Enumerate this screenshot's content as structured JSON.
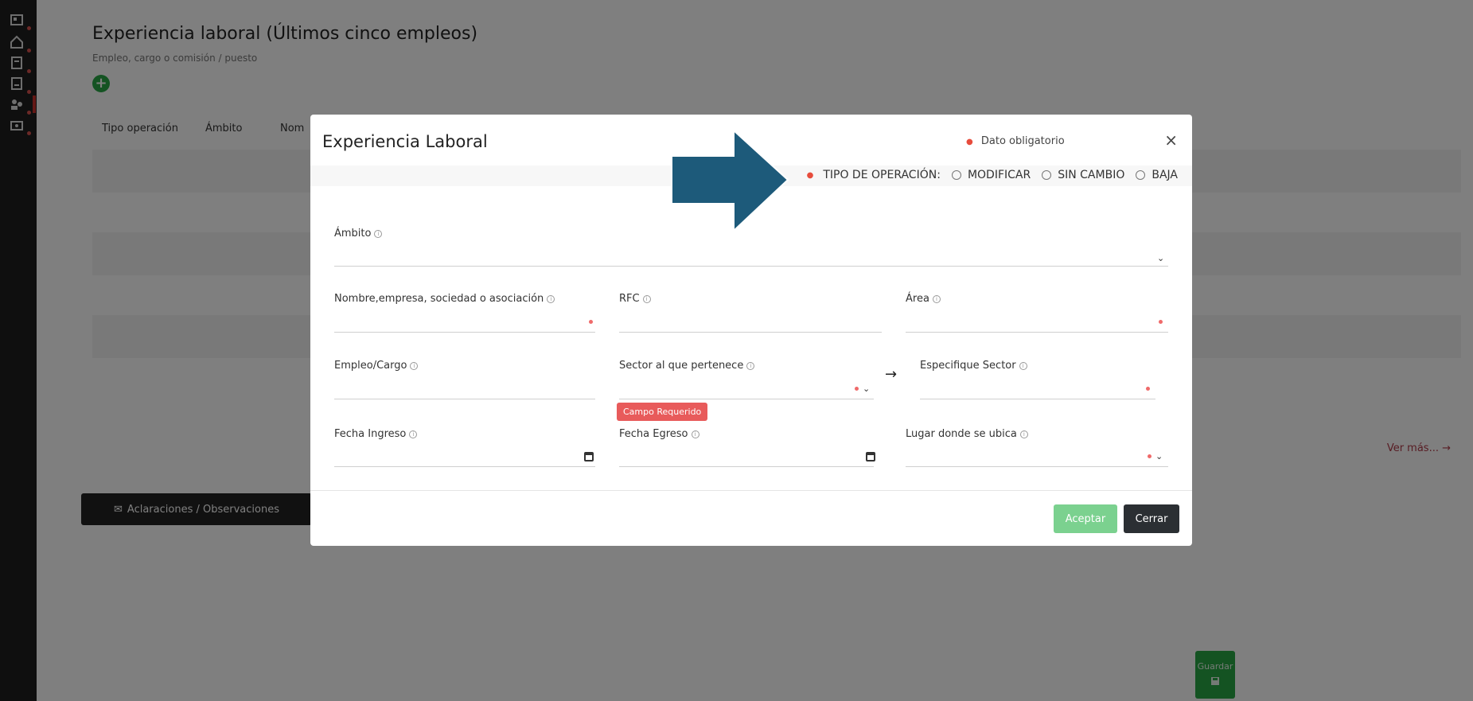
{
  "background": {
    "title": "Experiencia laboral (Últimos cinco empleos)",
    "subtitle": "Empleo, cargo o comisión / puesto",
    "add_icon": "plus-circle-icon",
    "table_headers": [
      "Tipo operación",
      "Ámbito",
      "Nom"
    ],
    "ver_mas": "Ver más... →",
    "aclaraciones_label": "Aclaraciones / Observaciones",
    "guardar_label": "Guardar"
  },
  "modal": {
    "title": "Experiencia Laboral",
    "required_note": "Dato obligatorio",
    "close_label": "×",
    "operation": {
      "label": "TIPO DE OPERACIÓN:",
      "options": [
        "MODIFICAR",
        "SIN CAMBIO",
        "BAJA"
      ]
    },
    "fields": {
      "ambito": "Ámbito",
      "nombre_empresa": "Nombre,empresa, sociedad o asociación",
      "rfc": "RFC",
      "area": "Área",
      "empleo_cargo": "Empleo/Cargo",
      "sector": "Sector al que pertenece",
      "especifique_sector": "Especifique Sector",
      "fecha_ingreso": "Fecha Ingreso",
      "fecha_egreso": "Fecha Egreso",
      "lugar": "Lugar donde se ubica"
    },
    "campo_requerido": "Campo Requerido",
    "buttons": {
      "aceptar": "Aceptar",
      "cerrar": "Cerrar"
    }
  },
  "colors": {
    "primary_green": "#28a745",
    "danger": "#e85b5b",
    "annotation_arrow": "#1d5a7a"
  }
}
